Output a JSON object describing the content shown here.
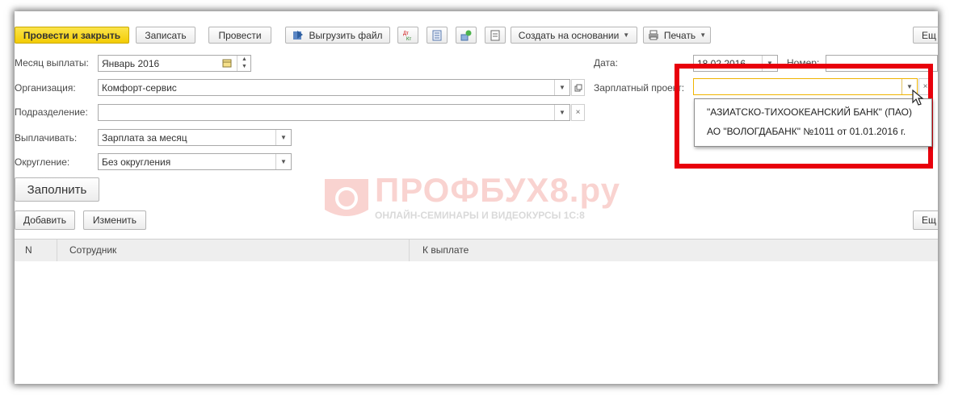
{
  "toolbar": {
    "post_and_close": "Провести и закрыть",
    "save": "Записать",
    "post": "Провести",
    "export_file": "Выгрузить файл",
    "create_based_on": "Создать на основании",
    "print": "Печать",
    "more": "Ещ"
  },
  "form": {
    "payment_month": {
      "label": "Месяц выплаты:",
      "value": "Январь 2016"
    },
    "organization": {
      "label": "Организация:",
      "value": "Комфорт-сервис"
    },
    "department": {
      "label": "Подразделение:",
      "value": ""
    },
    "pay_type": {
      "label": "Выплачивать:",
      "value": "Зарплата за месяц"
    },
    "rounding": {
      "label": "Округление:",
      "value": "Без округления"
    },
    "date": {
      "label": "Дата:",
      "value": "18.02.2016"
    },
    "number": {
      "label": "Номер:",
      "value": ""
    },
    "salary_project": {
      "label": "Зарплатный проект:",
      "value": ""
    }
  },
  "fill_button": "Заполнить",
  "table_toolbar": {
    "add": "Добавить",
    "edit": "Изменить",
    "more": "Ещ"
  },
  "table": {
    "columns": [
      "N",
      "Сотрудник",
      "К выплате"
    ]
  },
  "dropdown": {
    "items": [
      "\"АЗИАТСКО-ТИХООКЕАНСКИЙ БАНК\" (ПАО)",
      "АО \"ВОЛОГДАБАНК\" №1011 от 01.01.2016 г."
    ]
  },
  "watermark": {
    "title": "ПРОФБУХ8.ру",
    "subtitle": "ОНЛАЙН-СЕМИНАРЫ И ВИДЕОКУРСЫ 1С:8"
  },
  "colors": {
    "primary_button": "#f3cc05",
    "highlight_frame": "#e8000c",
    "active_field_border": "#f0b400"
  }
}
